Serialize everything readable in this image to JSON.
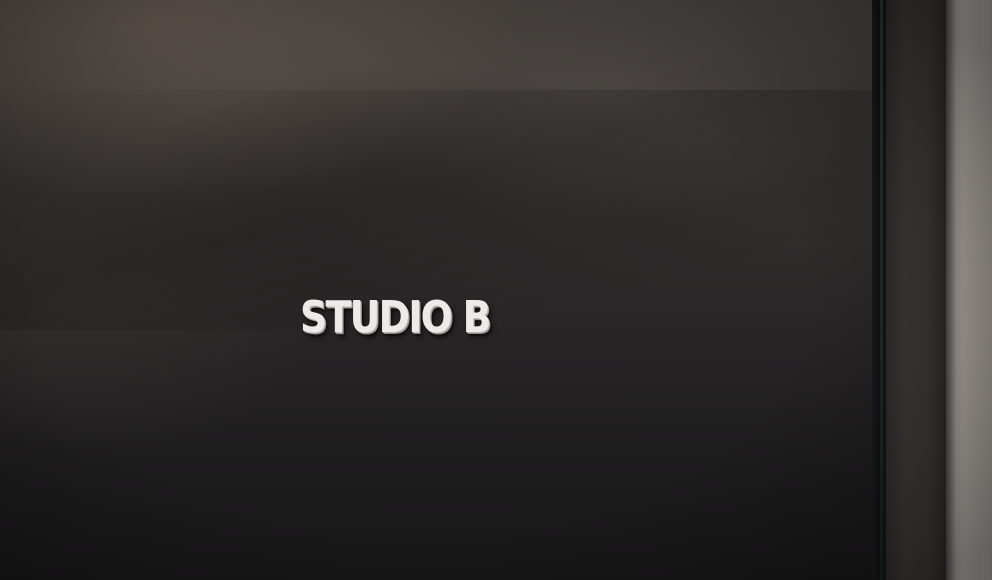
{
  "sign": {
    "text": "STUDIO B"
  },
  "colors": {
    "door": "#2f2c2c",
    "door_frame": "#3a3634",
    "wall": "#a9a39e",
    "lettering": "#ecebea"
  }
}
